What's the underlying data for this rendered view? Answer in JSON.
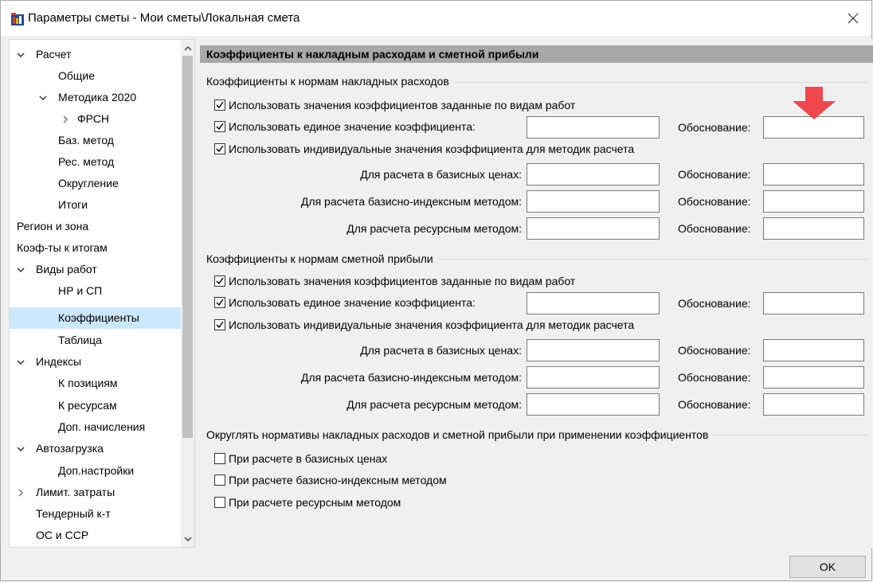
{
  "window": {
    "title": "Параметры сметы - Мои сметы\\Локальная смета"
  },
  "sidebar": {
    "items": [
      {
        "label": "Расчет",
        "expanded": true
      },
      {
        "label": "Общие"
      },
      {
        "label": "Методика 2020",
        "expanded": true
      },
      {
        "label": "ФРСН",
        "expanded": false
      },
      {
        "label": "Баз. метод"
      },
      {
        "label": "Рес. метод"
      },
      {
        "label": "Округление"
      },
      {
        "label": "Итоги"
      },
      {
        "label": "Регион и зона"
      },
      {
        "label": "Коэф-ты к итогам"
      },
      {
        "label": "Виды работ",
        "expanded": true
      },
      {
        "label": "НР и СП"
      },
      {
        "label": "Коэффициенты",
        "selected": true
      },
      {
        "label": "Таблица"
      },
      {
        "label": "Индексы",
        "expanded": true
      },
      {
        "label": "К позициям"
      },
      {
        "label": "К ресурсам"
      },
      {
        "label": "Доп. начисления"
      },
      {
        "label": "Автозагрузка",
        "expanded": true
      },
      {
        "label": "Доп.настройки"
      },
      {
        "label": "Лимит. затраты",
        "expanded": false
      },
      {
        "label": "Тендерный к-т"
      },
      {
        "label": "ОС и ССР"
      }
    ]
  },
  "main": {
    "header": "Коэффициенты к накладным расходам и сметной прибыли",
    "nr_group": {
      "title": "Коэффициенты к нормам накладных расходов",
      "check_by_work_types": "Использовать значения коэффициентов заданные по видам работ",
      "check_single_value": "Использовать единое значение коэффициента:",
      "check_individual": "Использовать индивидуальные значения коэффициента для методик расчета",
      "basic_prices": "Для расчета в базисных ценах:",
      "basic_index": "Для расчета базисно-индексным методом:",
      "resource": "Для расчета ресурсным методом:",
      "justification": "Обоснование:"
    },
    "sp_group": {
      "title": "Коэффициенты к нормам сметной прибыли",
      "check_by_work_types": "Использовать значения коэффициентов заданные по видам работ",
      "check_single_value": "Использовать единое значение коэффициента:",
      "check_individual": "Использовать индивидуальные значения коэффициента для методик расчета",
      "basic_prices": "Для расчета в базисных ценах:",
      "basic_index": "Для расчета базисно-индексным методом:",
      "resource": "Для расчета ресурсным методом:",
      "justification": "Обоснование:"
    },
    "round_group": {
      "title": "Округлять нормативы накладных расходов и сметной прибыли при применении коэффициентов",
      "basic_prices": "При расчете в базисных ценах",
      "basic_index": "При расчете базисно-индексным методом",
      "resource": "При расчете ресурсным методом"
    }
  },
  "footer": {
    "ok_label": "OK"
  },
  "colors": {
    "selection": "#cce8ff",
    "header_bar": "#a8a8a8",
    "arrow": "#f0474f"
  }
}
